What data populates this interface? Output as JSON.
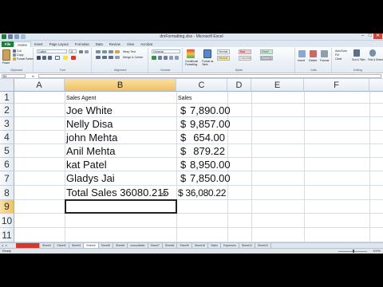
{
  "window": {
    "title": "dmFormatting.xlsx - Microsoft Excel",
    "minimize": "–",
    "maximize": "□",
    "close": "✕"
  },
  "ribbon_tabs": [
    "File",
    "Home",
    "Insert",
    "Page Layout",
    "Formulas",
    "Data",
    "Review",
    "View",
    "Acrobat"
  ],
  "ribbon": {
    "clipboard": {
      "paste": "Paste",
      "cut": "Cut",
      "copy": "Copy",
      "format_painter": "Format Painter",
      "label": "Clipboard"
    },
    "font": {
      "name": "Calibri",
      "size": "11",
      "label": "Font"
    },
    "alignment": {
      "wrap": "Wrap Text",
      "merge": "Merge & Center",
      "label": "Alignment"
    },
    "number": {
      "format": "General",
      "label": "Number"
    },
    "styles": {
      "conditional": "Conditional Formatting",
      "format_table": "Format as Table",
      "normal": "Normal",
      "bad": "Bad",
      "good": "Good",
      "neutral": "Neutral",
      "calculation": "Calculation",
      "check_cell": "Check Cell",
      "label": "Styles"
    },
    "cells": {
      "insert": "Insert",
      "delete": "Delete",
      "format": "Format",
      "label": "Cells"
    },
    "editing": {
      "autosum": "AutoSum",
      "fill": "Fill",
      "clear": "Clear",
      "sort": "Sort & Filter",
      "find": "Find & Select",
      "label": "Editing"
    }
  },
  "formula_bar": {
    "name_box": "B9",
    "fx": "fx",
    "content": ""
  },
  "columns": [
    "A",
    "B",
    "C",
    "D",
    "E",
    "F"
  ],
  "selected_column": "B",
  "rows": [
    "1",
    "2",
    "3",
    "4",
    "5",
    "6",
    "7",
    "8",
    "9",
    "10",
    "11"
  ],
  "selected_row": "9",
  "cells": {
    "B1": "Sales Agent",
    "C1": "Sales",
    "B2": "Joe  White",
    "B3": "Nelly Disa",
    "B4": "john Mehta",
    "B5": "Anil Mehta",
    "B6": "kat Patel",
    "B7": "Gladys Jai",
    "B8": "Total Sales  36080.215",
    "C2_sym": "$",
    "C2": "7,890.00",
    "C3_sym": "$",
    "C3": "9,857.00",
    "C4_sym": "$",
    "C4": "654.00",
    "C5_sym": "$",
    "C5": "879.22",
    "C6_sym": "$",
    "C6": "8,950.00",
    "C7_sym": "$",
    "C7": "7,850.00",
    "C8": "$ 36,080.22"
  },
  "sheet_tabs": [
    "",
    "Sheet1",
    "Sheet2",
    "Sheet3",
    "Sheet4",
    "Sheet5",
    "Sheet6",
    "consolidate",
    "Sheet7",
    "Sheet8",
    "Sheet9",
    "Sheet10",
    "Sales",
    "Expenses",
    "Sheet11",
    "Sheet12"
  ],
  "active_sheet_index": 4,
  "status": {
    "ready": "Ready",
    "zoom": "100%"
  },
  "colors": {
    "file_tab": "#1f7a3b",
    "selection_header": "#f1c15f",
    "active_border": "#222222"
  }
}
